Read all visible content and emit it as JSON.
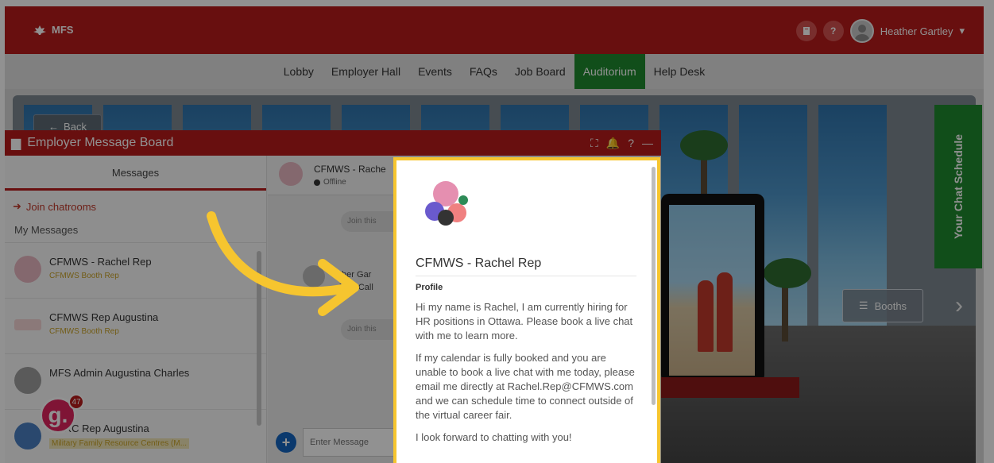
{
  "topbar": {
    "logo": "MFS",
    "help_icon": "?",
    "user_name": "Heather Gartley",
    "caret": "▾"
  },
  "nav": {
    "items": [
      {
        "label": "Lobby",
        "active": false
      },
      {
        "label": "Employer Hall",
        "active": false
      },
      {
        "label": "Events",
        "active": false
      },
      {
        "label": "FAQs",
        "active": false
      },
      {
        "label": "Job Board",
        "active": false
      },
      {
        "label": "Auditorium",
        "active": true
      },
      {
        "label": "Help Desk",
        "active": false
      }
    ]
  },
  "scene": {
    "back_label": "Back",
    "booths_label": "Booths",
    "chat_schedule": "Your Chat Schedule"
  },
  "board": {
    "title": "Employer Message Board",
    "tab": "Messages",
    "join_chatrooms": "Join chatrooms",
    "my_messages": "My Messages",
    "conversations": [
      {
        "name": "CFMWS - Rachel Rep",
        "sub": "CFMWS Booth Rep"
      },
      {
        "name": "CFMWS Rep Augustina",
        "sub": "CFMWS Booth Rep"
      },
      {
        "name": "MFS Admin Augustina Charles",
        "sub": ""
      },
      {
        "name": "MFRC Rep Augustina",
        "sub": "Military Family Resource Centres (M..."
      }
    ],
    "chat_header_name": "CFMWS - Rache",
    "chat_status": "Offline",
    "other_sender": "ther Gar",
    "video_call": "ideo Call",
    "join_pill_1": "Join this",
    "join_pill_2": "Join this",
    "input_placeholder": "Enter Message"
  },
  "fab": {
    "letter": "g.",
    "badge": "47"
  },
  "profile": {
    "name": "CFMWS - Rachel Rep",
    "section": "Profile",
    "paragraphs": [
      "Hi my name is Rachel, I am currently hiring for HR positions in Ottawa.  Please book a live chat with me to learn more.",
      "If my calendar is fully booked and you are unable to book a live chat with me today, please email me directly at Rachel.Rep@CFMWS.com and we can schedule time to connect outside of the virtual career fair.",
      "I look forward to chatting with you!"
    ]
  },
  "colors": {
    "brand_red": "#b71c1c",
    "accent_green": "#1e8a2e",
    "highlight_yellow": "#f6c52f"
  }
}
